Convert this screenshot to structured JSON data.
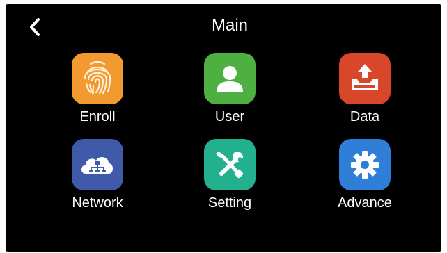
{
  "header": {
    "title": "Main",
    "back_icon": "chevron-left-icon"
  },
  "menu": {
    "items": [
      {
        "label": "Enroll",
        "icon": "fingerprint-icon",
        "color": "#f29a2f"
      },
      {
        "label": "User",
        "icon": "user-icon",
        "color": "#4db040"
      },
      {
        "label": "Data",
        "icon": "data-tray-icon",
        "color": "#d9472a"
      },
      {
        "label": "Network",
        "icon": "cloud-network-icon",
        "color": "#3f5aa8"
      },
      {
        "label": "Setting",
        "icon": "tools-icon",
        "color": "#22b08f"
      },
      {
        "label": "Advance",
        "icon": "gear-icon",
        "color": "#2f7fd8"
      }
    ]
  }
}
